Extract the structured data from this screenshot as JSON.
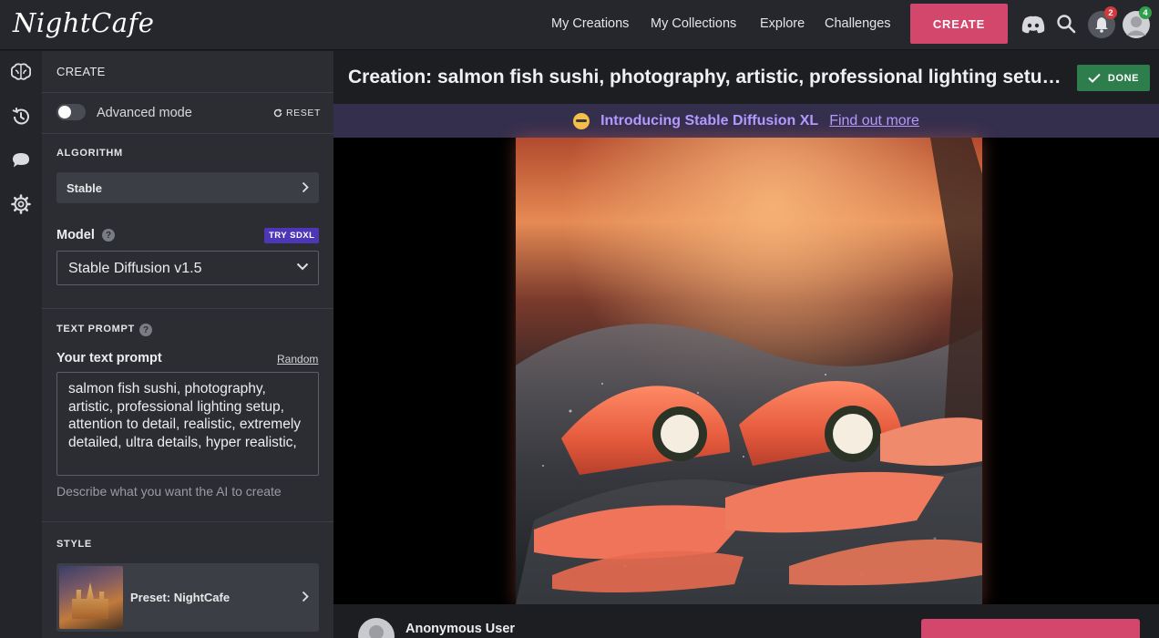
{
  "app": {
    "logo_text": "NightCafe"
  },
  "nav": {
    "links": [
      "My Creations",
      "My Collections",
      "Explore",
      "Challenges"
    ],
    "create_label": "CREATE",
    "notification_count": "2",
    "profile_badge_count": "4"
  },
  "rail": {
    "icons": [
      "brain-icon",
      "history-icon",
      "chat-icon",
      "gear-icon"
    ]
  },
  "panel": {
    "title": "CREATE",
    "advanced_mode_label": "Advanced mode",
    "advanced_mode_on": false,
    "reset_label": "RESET",
    "algorithm_label": "ALGORITHM",
    "algorithm_value": "Stable",
    "model_label": "Model",
    "help_glyph": "?",
    "try_sdxl_label": "TRY SDXL",
    "model_value": "Stable Diffusion v1.5",
    "text_prompt_label": "TEXT PROMPT",
    "your_prompt_label": "Your text prompt",
    "random_label": "Random",
    "prompt_value": "salmon fish sushi, photography, artistic, professional lighting setup, attention to detail, realistic, extremely detailed, ultra details, hyper realistic,",
    "prompt_hint": "Describe what you want the AI to create",
    "style_label": "STYLE",
    "style_value": "Preset: NightCafe"
  },
  "main": {
    "creation_title": "Creation: salmon fish sushi, photography, artistic, professional lighting setup, attention to detail, realistic, extremely detailed, ultra details, hyper realistic,",
    "done_label": "DONE",
    "announcement_text": "Introducing Stable Diffusion XL",
    "announcement_link": "Find out more",
    "user_name": "Anonymous User"
  },
  "colors": {
    "accent_pink": "#d2476b",
    "done_green": "#2e7d4c",
    "sdxl_purple": "#4d37b7",
    "announce_text": "#b49aff"
  }
}
